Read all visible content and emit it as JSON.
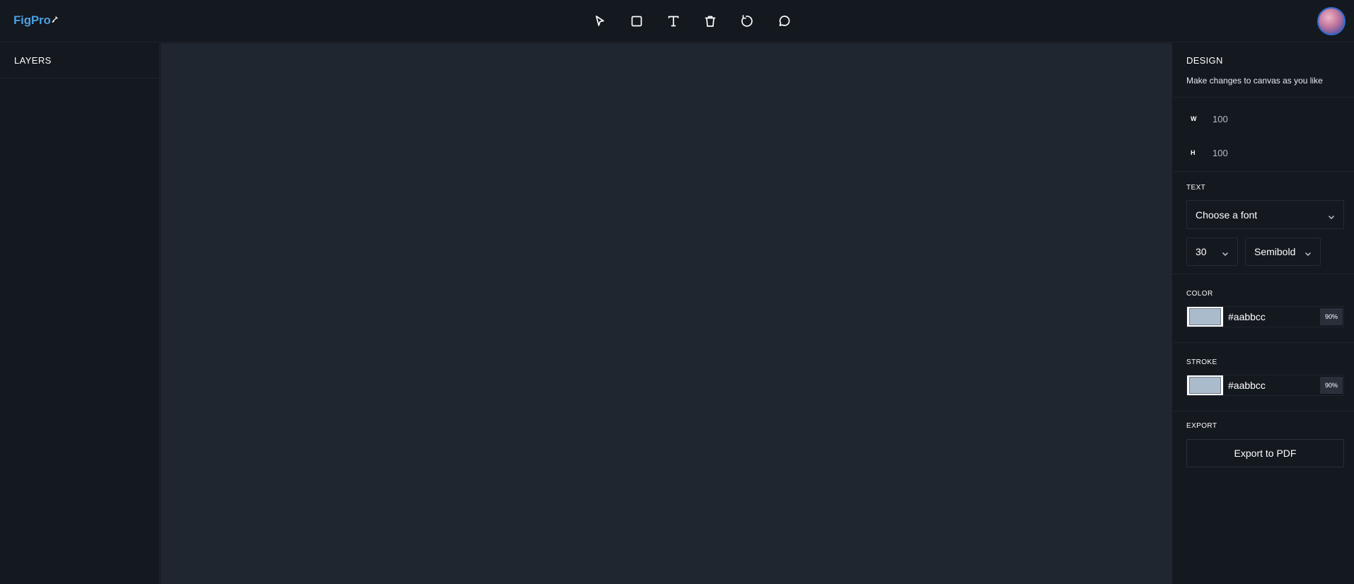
{
  "app": {
    "logo_text": "FigPro",
    "logo_icon": "pen-icon"
  },
  "toolbar": {
    "tools": [
      {
        "name": "select",
        "icon": "cursor-icon"
      },
      {
        "name": "rectangle",
        "icon": "square-icon"
      },
      {
        "name": "text",
        "icon": "text-icon"
      },
      {
        "name": "delete",
        "icon": "trash-icon"
      },
      {
        "name": "reset",
        "icon": "rotate-icon"
      },
      {
        "name": "comment",
        "icon": "chat-icon"
      }
    ]
  },
  "left_sidebar": {
    "title": "LAYERS"
  },
  "right_panel": {
    "design_title": "DESIGN",
    "design_subtitle": "Make changes to canvas as you like",
    "dimensions": {
      "width_label": "W",
      "width_value": "100",
      "height_label": "H",
      "height_value": "100"
    },
    "text": {
      "label": "TEXT",
      "font_placeholder": "Choose a font",
      "font_size": "30",
      "font_weight": "Semibold"
    },
    "color": {
      "label": "COLOR",
      "hex": "#aabbcc",
      "opacity": "90%",
      "swatch": "#aabbcc"
    },
    "stroke": {
      "label": "STROKE",
      "hex": "#aabbcc",
      "opacity": "90%",
      "swatch": "#aabbcc"
    },
    "export": {
      "label": "EXPORT",
      "button_label": "Export to PDF"
    }
  },
  "colors": {
    "background": "#14181f",
    "canvas": "#202630",
    "accent": "#4a9fe0"
  }
}
